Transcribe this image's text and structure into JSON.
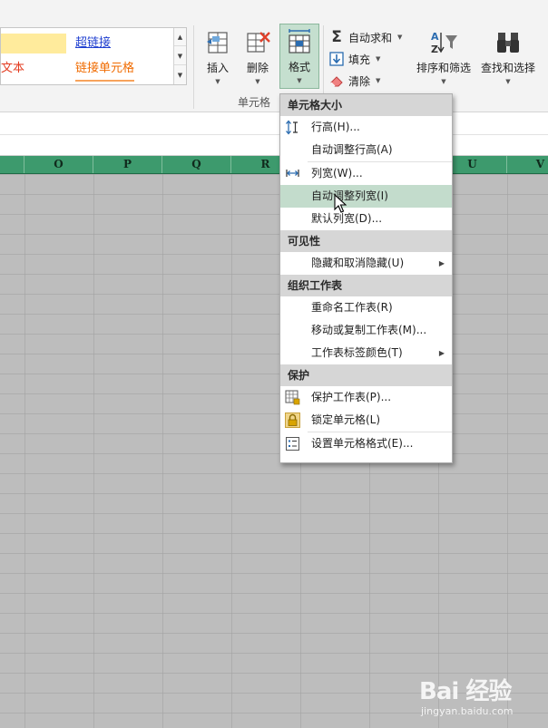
{
  "ribbon": {
    "styles": {
      "neutral": "",
      "hyperlink": "超链接",
      "warning_text": "文本",
      "linked_cell": "链接单元格"
    },
    "cells_group": {
      "insert_label": "插入",
      "delete_label": "删除",
      "format_label": "格式",
      "group_label": "单元格"
    },
    "editing": {
      "autosum_label": "自动求和",
      "fill_label": "填充",
      "clear_label": "清除",
      "sort_filter_label": "排序和筛选",
      "find_select_label": "查找和选择"
    }
  },
  "columns": [
    "O",
    "P",
    "Q",
    "R",
    "U",
    "V"
  ],
  "menu": {
    "sections": {
      "cell_size": "单元格大小",
      "visibility": "可见性",
      "organize": "组织工作表",
      "protection": "保护"
    },
    "items": {
      "row_height": "行高(H)...",
      "autofit_row": "自动调整行高(A)",
      "column_width": "列宽(W)...",
      "autofit_column": "自动调整列宽(I)",
      "default_width": "默认列宽(D)...",
      "hide_unhide": "隐藏和取消隐藏(U)",
      "rename_sheet": "重命名工作表(R)",
      "move_copy_sheet": "移动或复制工作表(M)...",
      "tab_color": "工作表标签颜色(T)",
      "protect_sheet": "保护工作表(P)...",
      "lock_cell": "锁定单元格(L)",
      "format_cells": "设置单元格格式(E)..."
    }
  },
  "watermark": {
    "brand": "Bai 经验",
    "url": "jingyan.baidu.com"
  },
  "colors": {
    "accent_green": "#2b8a5c",
    "active_item": "#c3dccc",
    "grid_bg": "#bdbdbd"
  }
}
